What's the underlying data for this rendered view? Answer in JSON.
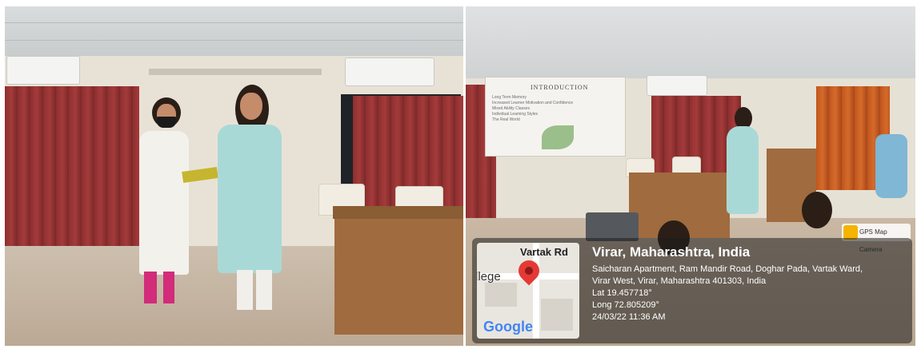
{
  "gps_overlay": {
    "map_road_label": "Vartak Rd",
    "map_place_label": "llege",
    "map_logo": "Google",
    "badge_label": "GPS Map Camera",
    "location_title": "Virar, Maharashtra, India",
    "address_line_1": "Saicharan Apartment, Ram Mandir Road, Doghar Pada, Vartak Ward,",
    "address_line_2": "Virar West, Virar, Maharashtra 401303, India",
    "latitude": "Lat 19.457718°",
    "longitude": "Long 72.805209°",
    "timestamp": "24/03/22 11:36 AM",
    "pin_color": "#e53935"
  },
  "projector_slide": {
    "title": "INTRODUCTION",
    "bullets": [
      "Long Term Memory",
      "Increased Learner Motivation and Confidence",
      "Mixed Ability Classes",
      "Individual Learning Styles",
      "The Real World"
    ]
  },
  "colors": {
    "curtain": "#8e2f2f",
    "kurta_teal": "#a9d9d6",
    "desk": "#a06b3e"
  }
}
